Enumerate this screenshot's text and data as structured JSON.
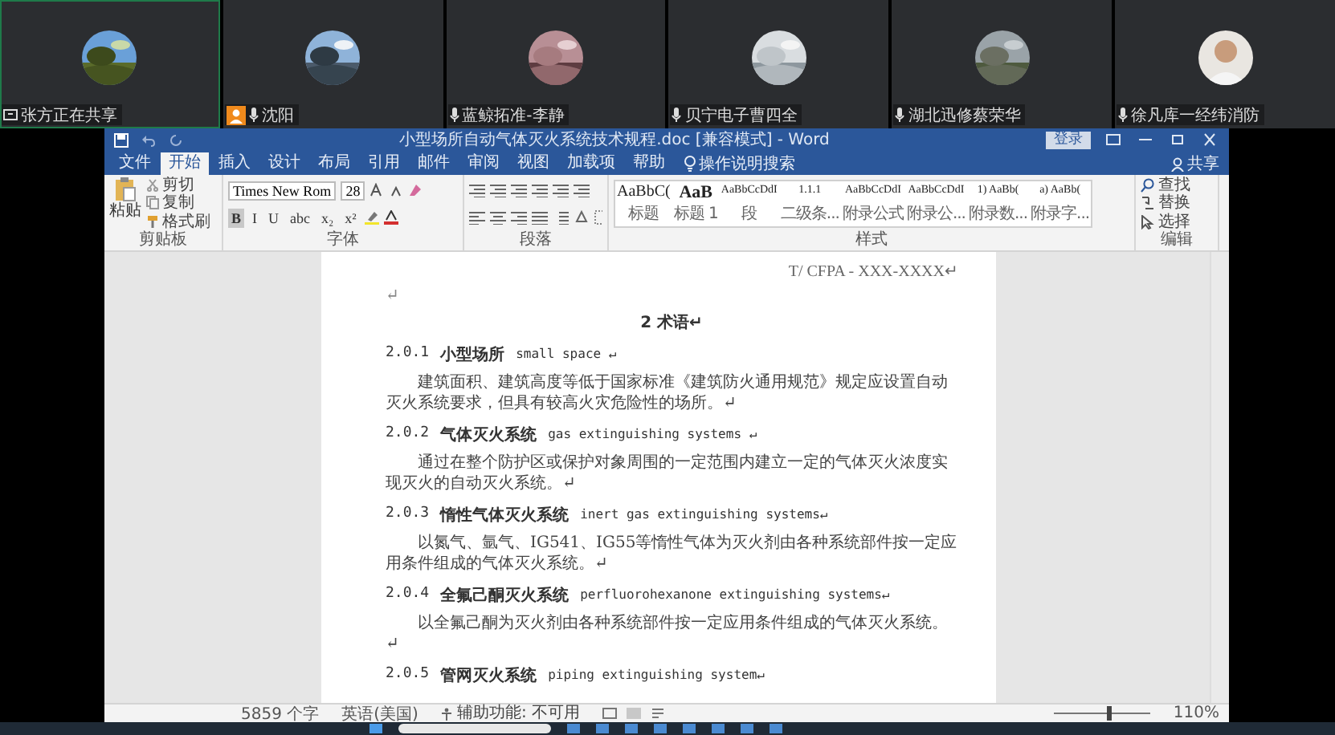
{
  "participants": [
    {
      "name": "张方正在共享",
      "kind": "sharing",
      "host": false,
      "speaking": true
    },
    {
      "name": "沈阳",
      "kind": "mic",
      "host": true,
      "speaking": false
    },
    {
      "name": "蓝鲸拓准-李静",
      "kind": "mic",
      "host": false,
      "speaking": false
    },
    {
      "name": "贝宁电子曹四全",
      "kind": "mic",
      "host": false,
      "speaking": false
    },
    {
      "name": "湖北迅修蔡荣华",
      "kind": "mic",
      "host": false,
      "speaking": false
    },
    {
      "name": "徐凡库一经纬消防",
      "kind": "mic",
      "host": false,
      "speaking": false
    }
  ],
  "window": {
    "title": "小型场所自动气体灭火系统技术规程.doc [兼容模式] - Word",
    "signin": "登录"
  },
  "tabs": [
    {
      "label": "文件",
      "selected": false
    },
    {
      "label": "开始",
      "selected": true
    },
    {
      "label": "插入",
      "selected": false
    },
    {
      "label": "设计",
      "selected": false
    },
    {
      "label": "布局",
      "selected": false
    },
    {
      "label": "引用",
      "selected": false
    },
    {
      "label": "邮件",
      "selected": false
    },
    {
      "label": "审阅",
      "selected": false
    },
    {
      "label": "视图",
      "selected": false
    },
    {
      "label": "加载项",
      "selected": false
    },
    {
      "label": "帮助",
      "selected": false
    }
  ],
  "tell_me": "操作说明搜索",
  "share": "共享",
  "ribbon": {
    "clipboard": {
      "paste": "粘贴",
      "cut": "剪切",
      "copy": "复制",
      "format_painter": "格式刷",
      "label": "剪贴板"
    },
    "font": {
      "font_name": "Times New Rom",
      "font_size": "28",
      "format_buttons": [
        "B",
        "I",
        "U",
        "abc",
        "x₂",
        "x²"
      ],
      "label": "字体"
    },
    "paragraph": {
      "label": "段落"
    },
    "styles": {
      "label": "样式",
      "items": [
        {
          "preview": "AaBbC(",
          "name": "标题",
          "kind": "title"
        },
        {
          "preview": "AaB",
          "name": "标题 1",
          "kind": "heading"
        },
        {
          "preview": "AaBbCcDdI",
          "name": "段",
          "kind": "body"
        },
        {
          "preview": "1.1.1",
          "name": "二级条...",
          "kind": "body"
        },
        {
          "preview": "AaBbCcDdI",
          "name": "附录公式",
          "kind": "body"
        },
        {
          "preview": "AaBbCcDdI",
          "name": "附录公...",
          "kind": "body"
        },
        {
          "preview": "1)  AaBb(",
          "name": "附录数...",
          "kind": "body"
        },
        {
          "preview": "a)  AaBb(",
          "name": "附录字...",
          "kind": "body"
        }
      ]
    },
    "editing": {
      "label": "编辑",
      "find": "查找",
      "replace": "替换",
      "select": "选择"
    }
  },
  "document": {
    "header": "T/ CFPA - XXX-XXXX↵",
    "blank": "↵",
    "chapter": "2  术语↵",
    "sections": [
      {
        "number": "2.0.1",
        "title": "小型场所",
        "english": "small space ↵",
        "body": "建筑面积、建筑高度等低于国家标准《建筑防火通用规范》规定应设置自动灭火系统要求，但具有较高火灾危险性的场所。↵"
      },
      {
        "number": "2.0.2",
        "title": "气体灭火系统",
        "english": "gas extinguishing systems ↵",
        "body": "通过在整个防护区或保护对象周围的一定范围内建立一定的气体灭火浓度实现灭火的自动灭火系统。↵"
      },
      {
        "number": "2.0.3",
        "title": "惰性气体灭火系统",
        "english": "inert gas extinguishing systems↵",
        "body": "以氮气、氩气、IG541、IG55等惰性气体为灭火剂由各种系统部件按一定应用条件组成的气体灭火系统。↵"
      },
      {
        "number": "2.0.4",
        "title": "全氟己酮灭火系统",
        "english": "perfluorohexanone extinguishing systems↵",
        "body": "以全氟己酮为灭火剂由各种系统部件按一定应用条件组成的气体灭火系统。↵"
      },
      {
        "number": "2.0.5",
        "title": "管网灭火系统",
        "english": "piping extinguishing system↵"
      }
    ]
  },
  "status_bar": {
    "words": "5859 个字",
    "language": "英语(美国)",
    "accessibility": "辅助功能: 不可用",
    "zoom": "110%",
    "zoom_slider": {
      "level": 0.55
    }
  }
}
